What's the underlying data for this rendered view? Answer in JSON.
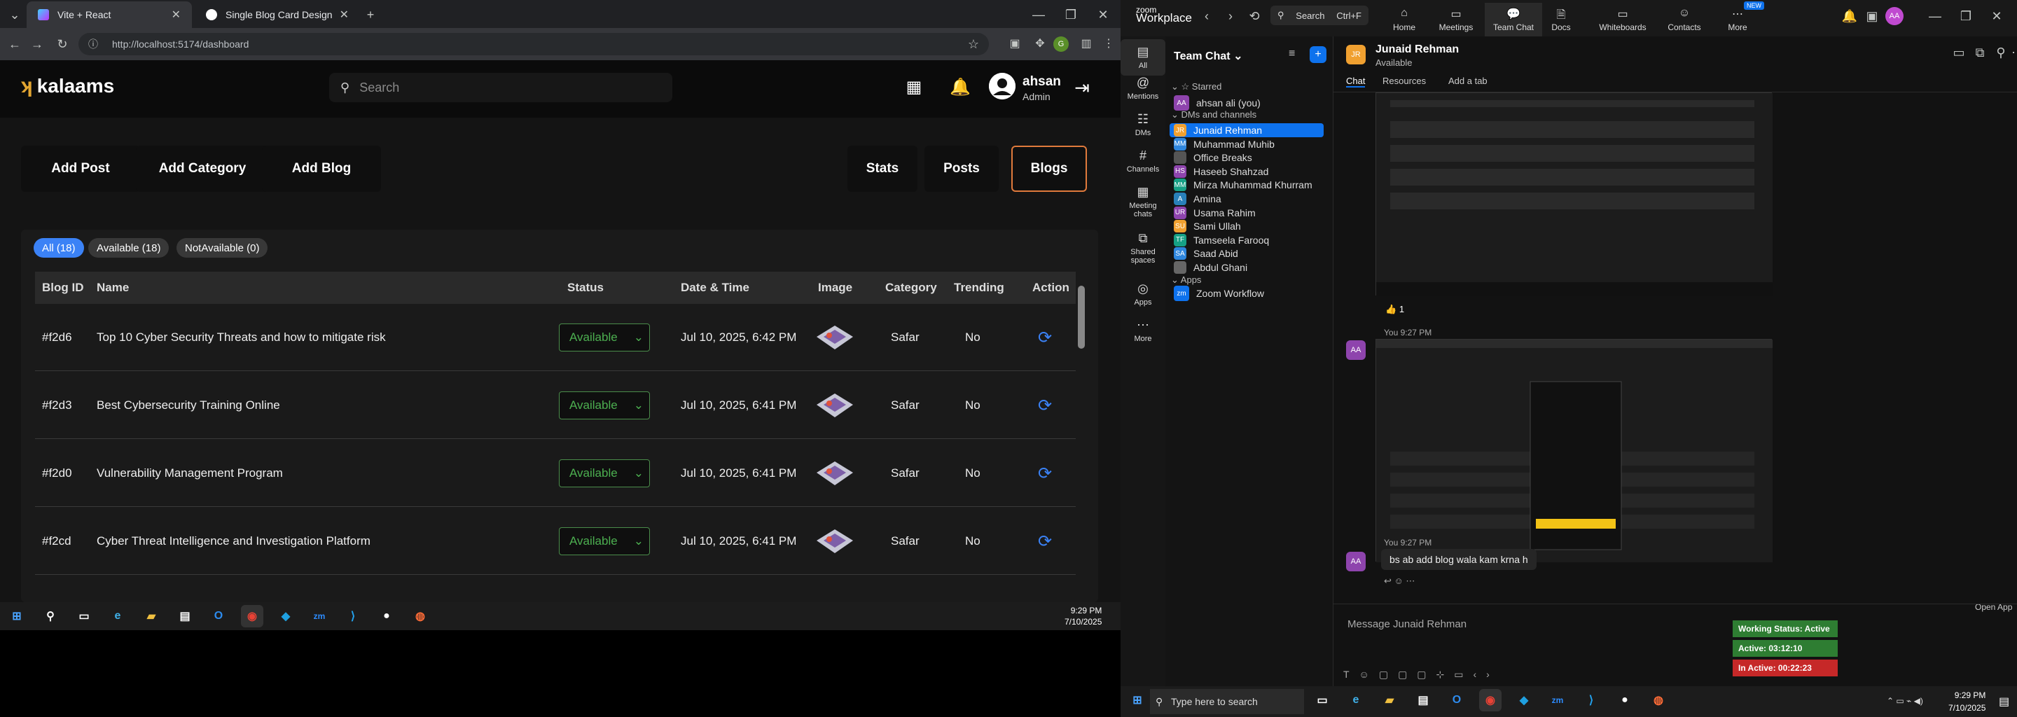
{
  "browser": {
    "tabs": [
      {
        "title": "Vite + React",
        "active": true
      },
      {
        "title": "Single Blog Card Design",
        "active": false
      }
    ],
    "url": "http://localhost:5174/dashboard"
  },
  "app": {
    "logo_text": "kalaams",
    "search_placeholder": "Search",
    "user": {
      "name": "ahsan",
      "role": "Admin"
    },
    "actions_left": [
      "Add Post",
      "Add Category",
      "Add Blog"
    ],
    "actions_right": [
      "Stats",
      "Posts",
      "Blogs"
    ],
    "filters": [
      "All (18)",
      "Available (18)",
      "NotAvailable (0)"
    ],
    "columns": [
      "Blog ID",
      "Name",
      "Status",
      "Date & Time",
      "Image",
      "Category",
      "Trending",
      "Action"
    ],
    "rows": [
      {
        "id": "#f2d6",
        "name": "Top 10 Cyber Security Threats and how to mitigate risk",
        "status": "Available",
        "date": "Jul 10, 2025, 6:42 PM",
        "category": "Safar",
        "trending": "No"
      },
      {
        "id": "#f2d3",
        "name": "Best Cybersecurity Training Online",
        "status": "Available",
        "date": "Jul 10, 2025, 6:41 PM",
        "category": "Safar",
        "trending": "No"
      },
      {
        "id": "#f2d0",
        "name": "Vulnerability Management Program",
        "status": "Available",
        "date": "Jul 10, 2025, 6:41 PM",
        "category": "Safar",
        "trending": "No"
      },
      {
        "id": "#f2cd",
        "name": "Cyber Threat Intelligence and Investigation Platform",
        "status": "Available",
        "date": "Jul 10, 2025, 6:41 PM",
        "category": "Safar",
        "trending": "No"
      }
    ]
  },
  "left_taskbar": {
    "time": "9:29 PM",
    "date": "7/10/2025"
  },
  "zoom": {
    "brand_top": "zoom",
    "brand_bottom": "Workplace",
    "search_label": "Search",
    "search_shortcut": "Ctrl+F",
    "tabs": [
      "Home",
      "Meetings",
      "Team Chat",
      "Docs",
      "Whiteboards",
      "Contacts",
      "More"
    ],
    "more_badge": "NEW",
    "rail": [
      "All",
      "Mentions",
      "DMs",
      "Channels",
      "Meeting chats",
      "Shared spaces",
      "Apps",
      "More"
    ],
    "list_title": "Team Chat",
    "sections": {
      "starred": "Starred",
      "dms": "DMs and channels",
      "apps": "Apps"
    },
    "starred": [
      {
        "initials": "AA",
        "name": "ahsan ali (you)"
      }
    ],
    "contacts": [
      {
        "initials": "JR",
        "name": "Junaid Rehman"
      },
      {
        "initials": "MM",
        "name": "Muhammad Muhib"
      },
      {
        "initials": "",
        "name": "Office Breaks"
      },
      {
        "initials": "HS",
        "name": "Haseeb Shahzad"
      },
      {
        "initials": "MM",
        "name": "Mirza Muhammad Khurram"
      },
      {
        "initials": "A",
        "name": "Amina"
      },
      {
        "initials": "UR",
        "name": "Usama Rahim"
      },
      {
        "initials": "SU",
        "name": "Sami Ullah"
      },
      {
        "initials": "TF",
        "name": "Tamseela Farooq"
      },
      {
        "initials": "SA",
        "name": "Saad Abid"
      },
      {
        "initials": "",
        "name": "Abdul Ghani"
      }
    ],
    "apps": [
      {
        "name": "Zoom Workflow"
      }
    ],
    "chat": {
      "name": "Junaid Rehman",
      "status": "Available",
      "tabs": [
        "Chat",
        "Resources",
        "Add a tab"
      ],
      "reaction": "1",
      "msg_time_1": "You 9:27 PM",
      "msg_time_2": "You 9:27 PM",
      "message": "bs ab add blog wala kam krna h",
      "composer_placeholder": "Message Junaid Rehman"
    },
    "open_app": "Open App",
    "status_boxes": [
      {
        "text": "Working Status: Active",
        "color": "#2e7d32"
      },
      {
        "text": "Active: 03:12:10",
        "color": "#2e7d32"
      },
      {
        "text": "In Active: 00:22:23",
        "color": "#c62828"
      }
    ]
  },
  "right_taskbar": {
    "search": "Type here to search",
    "time": "9:29 PM",
    "date": "7/10/2025"
  }
}
